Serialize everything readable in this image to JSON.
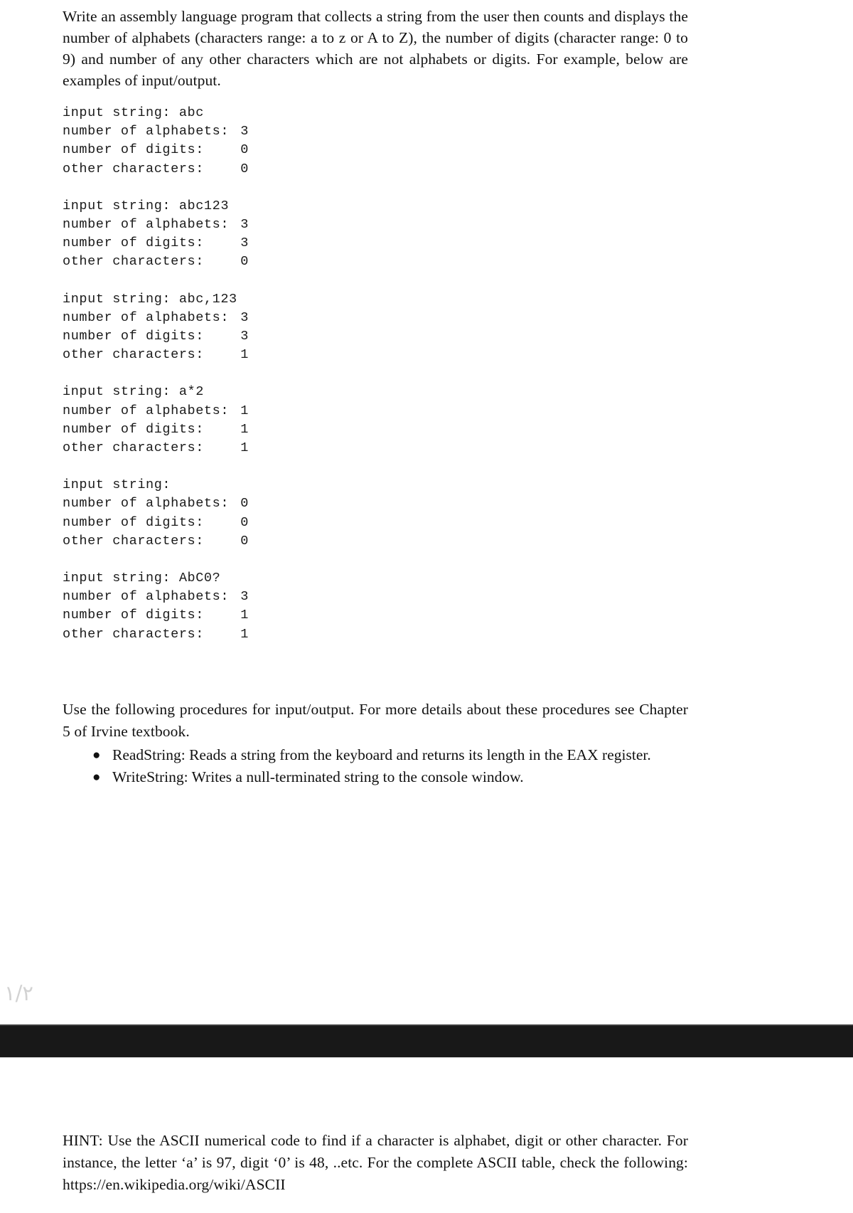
{
  "document": {
    "intro_paragraph": "Write an assembly language program that collects a string from the user then counts and displays the number of alphabets (characters range: a to z or A to Z), the number of  digits (character range: 0 to 9) and number of any other characters which are not alphabets or digits. For example, below are examples of input/output.",
    "samples": [
      {
        "input_label": "input string: ",
        "input_value": "abc",
        "rows": [
          {
            "label": "number of alphabets:",
            "value": "3"
          },
          {
            "label": "number of digits:",
            "value": "0"
          },
          {
            "label": "other characters:",
            "value": "0"
          }
        ]
      },
      {
        "input_label": "input string: ",
        "input_value": "abc123",
        "rows": [
          {
            "label": "number of alphabets:",
            "value": "3"
          },
          {
            "label": "number of digits:",
            "value": "3"
          },
          {
            "label": "other characters:",
            "value": "0"
          }
        ]
      },
      {
        "input_label": "input string: ",
        "input_value": "abc,123",
        "rows": [
          {
            "label": "number of alphabets:",
            "value": "3"
          },
          {
            "label": "number of digits:",
            "value": "3"
          },
          {
            "label": "other characters:",
            "value": "1"
          }
        ]
      },
      {
        "input_label": "input string: ",
        "input_value": "a*2",
        "rows": [
          {
            "label": "number of alphabets:",
            "value": "1"
          },
          {
            "label": "number of digits:",
            "value": "1"
          },
          {
            "label": "other characters:",
            "value": "1"
          }
        ]
      },
      {
        "input_label": "input string:",
        "input_value": "",
        "rows": [
          {
            "label": "number of alphabets:",
            "value": "0"
          },
          {
            "label": "number of digits:",
            "value": "0"
          },
          {
            "label": "other characters:",
            "value": "0"
          }
        ]
      },
      {
        "input_label": "input string: ",
        "input_value": "AbC0?",
        "rows": [
          {
            "label": "number of alphabets:",
            "value": "3"
          },
          {
            "label": "number of digits:",
            "value": "1"
          },
          {
            "label": "other characters:",
            "value": "1"
          }
        ]
      }
    ],
    "procedures": {
      "intro": "Use the following procedures for input/output. For more details about these procedures see Chapter 5 of Irvine textbook.",
      "bullet_glyph": "●",
      "items": [
        "ReadString: Reads a string from the keyboard and returns its length in the EAX register.",
        "WriteString: Writes a null-terminated string to the console window."
      ]
    },
    "page_marker": "٢/١",
    "hint": "HINT: Use the ASCII numerical code to find if a character is alphabet, digit or other character. For instance, the letter ‘a’ is 97, digit ‘0’ is 48, ..etc. For the complete ASCII table, check the following: https://en.wikipedia.org/wiki/ASCII"
  },
  "colors": {
    "page_background": "#ffffff",
    "body_text": "#111111",
    "code_text": "#1a1a1a",
    "separator_bar": "#181818",
    "page_marker": "#d2d2d2"
  }
}
